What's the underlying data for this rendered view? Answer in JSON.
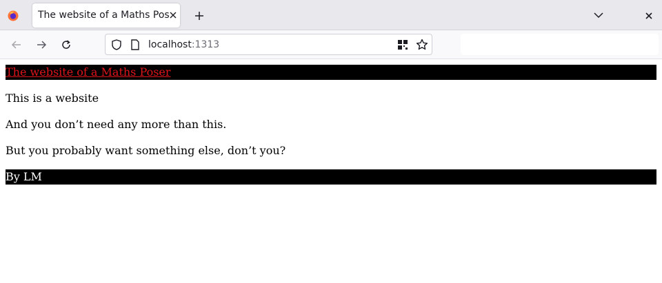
{
  "browser": {
    "tab": {
      "title": "The website of a Maths Poser"
    },
    "url": {
      "host": "localhost",
      "port": ":1313"
    },
    "icons": {
      "app": "firefox-icon",
      "tab_close": "close-icon",
      "new_tab": "plus-icon",
      "list_tabs": "chevron-down-icon",
      "window_close": "close-icon",
      "back": "arrow-left-icon",
      "forward": "arrow-right-icon",
      "reload": "reload-icon",
      "tracking": "shield-icon",
      "page": "page-icon",
      "qr": "qr-code-icon",
      "bookmark": "star-icon"
    }
  },
  "page": {
    "header_link": "The website of a Maths Poser",
    "paragraphs": [
      "This is a website",
      "And you don’t need any more than this.",
      "But you probably want something else, don’t you?"
    ],
    "footer": "By LM",
    "colors": {
      "bar": "#000000",
      "link": "#e0141b",
      "footer_text": "#ffffff"
    }
  }
}
